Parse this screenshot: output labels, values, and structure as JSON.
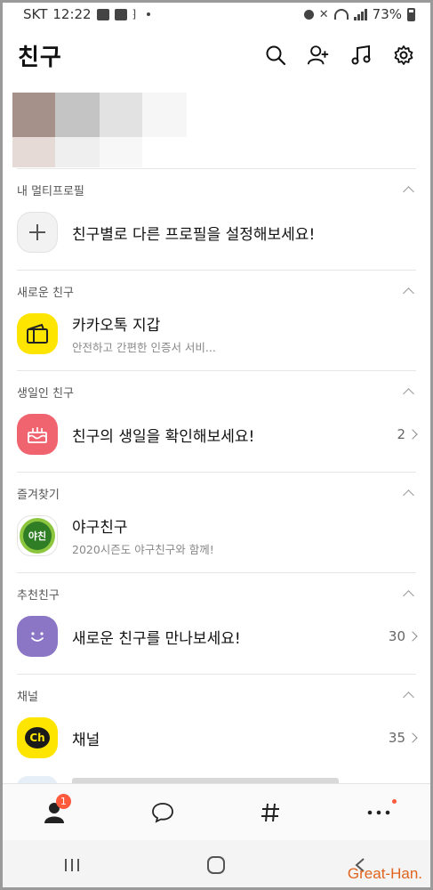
{
  "status_bar": {
    "carrier": "SKT",
    "time": "12:22",
    "battery": "73%"
  },
  "header": {
    "title": "친구",
    "icons": [
      "search-icon",
      "add-friend-icon",
      "music-icon",
      "settings-icon"
    ]
  },
  "sections": {
    "multi_profile": {
      "heading": "내 멀티프로필",
      "title": "친구별로 다른 프로필을 설정해보세요!"
    },
    "new_friends": {
      "heading": "새로운 친구",
      "title": "카카오톡 지갑",
      "subtitle": "안전하고 간편한 인증서 서비..."
    },
    "birthday": {
      "heading": "생일인 친구",
      "title": "친구의 생일을 확인해보세요!",
      "count": "2"
    },
    "favorites": {
      "heading": "즐겨찾기",
      "title": "야구친구",
      "subtitle": "2020시즌도 야구친구와 함께!",
      "logo_text": "야친"
    },
    "recommended": {
      "heading": "추천친구",
      "title": "새로운 친구를 만나보세요!",
      "count": "30"
    },
    "channel": {
      "heading": "채널",
      "title": "채널",
      "count": "35",
      "logo_text": "Ch"
    }
  },
  "tabbar": {
    "friends_badge": "1"
  },
  "watermark": "Great-Han.",
  "colors": {
    "kakao_yellow": "#FEE500",
    "birthday_red": "#F06470",
    "recommend_purple": "#8B76C6",
    "baseball_green": "#8CC63F",
    "badge": "#FF5A3C"
  }
}
